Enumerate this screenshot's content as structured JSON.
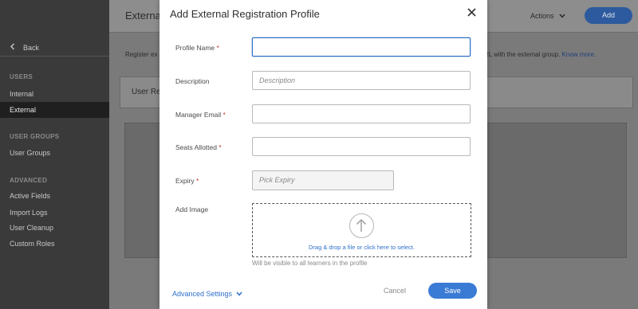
{
  "sidebar": {
    "back_label": "Back",
    "sections": [
      {
        "header": "USERS",
        "items": [
          {
            "label": "Internal"
          },
          {
            "label": "External",
            "active": true
          }
        ]
      },
      {
        "header": "USER GROUPS",
        "items": [
          {
            "label": "User Groups"
          }
        ]
      },
      {
        "header": "ADVANCED",
        "items": [
          {
            "label": "Active Fields"
          },
          {
            "label": "Import Logs"
          },
          {
            "label": "User Cleanup"
          },
          {
            "label": "Custom Roles"
          }
        ]
      }
    ]
  },
  "main": {
    "title": "Externa",
    "actions_label": "Actions",
    "add_label": "Add",
    "register_text": "Register ex",
    "register_right_text": "RL with the external group.",
    "know_more": "Know more.",
    "user_reg_text": "User Regi"
  },
  "modal": {
    "title": "Add External Registration Profile",
    "fields": {
      "profile_name": {
        "label": "Profile Name",
        "value": "",
        "placeholder": ""
      },
      "description": {
        "label": "Description",
        "value": "",
        "placeholder": "Description"
      },
      "manager_email": {
        "label": "Manager Email",
        "value": "",
        "placeholder": ""
      },
      "seats_allotted": {
        "label": "Seats Allotted",
        "value": "",
        "placeholder": ""
      },
      "expiry": {
        "label": "Expiry",
        "placeholder": "Pick Expiry"
      },
      "add_image": {
        "label": "Add Image",
        "drop_text": "Drag & drop a file or click here to select.",
        "hint": "Will be visible to all learners in the profile"
      }
    },
    "required_marker": "*",
    "advanced_settings": "Advanced Settings",
    "cancel": "Cancel",
    "save": "Save"
  },
  "colors": {
    "accent": "#3a7bd5",
    "required": "#c0392b",
    "sidebar_bg": "#3a3a3a",
    "overlay_bg": "#7a7a7a"
  }
}
